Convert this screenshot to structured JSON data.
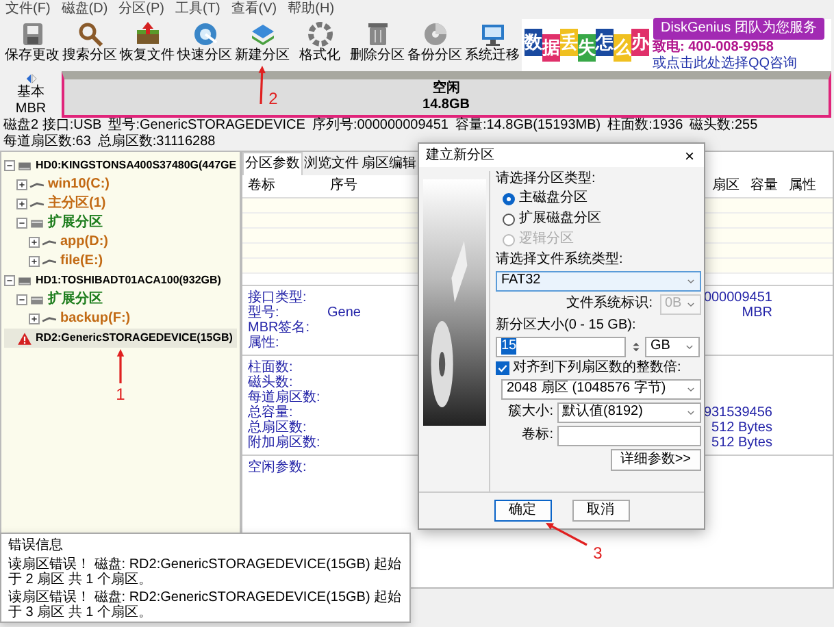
{
  "menu": [
    "文件(F)",
    "磁盘(D)",
    "分区(P)",
    "工具(T)",
    "查看(V)",
    "帮助(H)"
  ],
  "toolbar": [
    {
      "label": "保存更改"
    },
    {
      "label": "搜索分区"
    },
    {
      "label": "恢复文件"
    },
    {
      "label": "快速分区"
    },
    {
      "label": "新建分区"
    },
    {
      "label": "格式化"
    },
    {
      "label": "删除分区"
    },
    {
      "label": "备份分区"
    },
    {
      "label": "系统迁移"
    }
  ],
  "banner": {
    "characters": [
      "数",
      "据",
      "丢",
      "失",
      "怎",
      "么",
      "办"
    ],
    "slogan": "DiskGenius 团队为您服务",
    "phone": "致电: 400-008-9958",
    "note": "或点击此处选择QQ咨询"
  },
  "disk_map": {
    "type_label": "基本",
    "scheme": "MBR",
    "partition_label": "空闲",
    "partition_size": "14.8GB"
  },
  "disk_info": [
    "磁盘2 接口:USB",
    "型号:GenericSTORAGEDEVICE",
    "序列号:000000009451",
    "容量:14.8GB(15193MB)",
    "柱面数:1936",
    "磁头数:255",
    "每道扇区数:63",
    "总扇区数:31116288"
  ],
  "tree": [
    {
      "label": "HD0:KINGSTONSA400S37480G(447GE",
      "kind": "disk",
      "expanded": true,
      "selected": false,
      "children": [
        {
          "label": "win10(C:)",
          "kind": "partition",
          "expanded": false,
          "selected": false
        },
        {
          "label": "主分区(1)",
          "kind": "partition",
          "expanded": false,
          "selected": false
        },
        {
          "label": "扩展分区",
          "kind": "extended",
          "expanded": true,
          "selected": false,
          "children": [
            {
              "label": "app(D:)",
              "kind": "partition",
              "expanded": false,
              "selected": false
            },
            {
              "label": "file(E:)",
              "kind": "partition",
              "expanded": false,
              "selected": false
            }
          ]
        }
      ]
    },
    {
      "label": "HD1:TOSHIBADT01ACA100(932GB)",
      "kind": "disk",
      "expanded": true,
      "selected": false,
      "children": [
        {
          "label": "扩展分区",
          "kind": "extended",
          "expanded": true,
          "selected": false,
          "children": [
            {
              "label": "backup(F:)",
              "kind": "partition",
              "expanded": false,
              "selected": false
            }
          ]
        }
      ]
    },
    {
      "label": "RD2:GenericSTORAGEDEVICE(15GB)",
      "kind": "removable",
      "selected": true
    }
  ],
  "tabs": [
    {
      "label": "分区参数",
      "selected": true
    },
    {
      "label": "浏览文件",
      "selected": false
    },
    {
      "label": "扇区编辑",
      "selected": false
    }
  ],
  "table": {
    "columns": [
      "卷标",
      "序号",
      "扇区",
      "容量",
      "属性"
    ]
  },
  "details": [
    [
      {
        "label": "接口类型:",
        "far_value": "000009451"
      },
      {
        "label": "型号:",
        "value": "Gene",
        "far_value": "MBR"
      },
      {
        "label": "MBR签名:"
      },
      {
        "label": "属性:"
      }
    ],
    [
      {
        "label": "柱面数:"
      },
      {
        "label": "磁头数:"
      },
      {
        "label": "每道扇区数:"
      },
      {
        "label": "总容量:",
        "far_value": "931539456"
      },
      {
        "label": "总扇区数:",
        "far_value": "512 Bytes"
      },
      {
        "label": "附加扇区数:",
        "far_value": "512 Bytes"
      }
    ],
    [
      {
        "label": "空闲参数:"
      }
    ]
  ],
  "error_window": {
    "title": "错误信息",
    "lines": [
      "读扇区错误！ 磁盘: RD2:GenericSTORAGEDEVICE(15GB) 起始于 2 扇区 共 1 个扇区。",
      "读扇区错误！ 磁盘: RD2:GenericSTORAGEDEVICE(15GB) 起始于 3 扇区 共 1 个扇区。"
    ]
  },
  "dialog": {
    "title": "建立新分区",
    "close": "×",
    "type_label": "请选择分区类型:",
    "types": [
      {
        "label": "主磁盘分区",
        "selected": true,
        "disabled": false
      },
      {
        "label": "扩展磁盘分区",
        "selected": false,
        "disabled": false
      },
      {
        "label": "逻辑分区",
        "selected": false,
        "disabled": true
      }
    ],
    "fs_label": "请选择文件系统类型:",
    "fs_value": "FAT32",
    "fs_id_label": "文件系统标识:",
    "fs_id_value": "0B",
    "fs_id_disabled": true,
    "size_label": "新分区大小(0 - 15 GB):",
    "size_value": "15",
    "size_unit": "GB",
    "align": {
      "label": "对齐到下列扇区数的整数倍:",
      "checked": true
    },
    "align_value": "2048 扇区 (1048576 字节)",
    "cluster_label": "簇大小:",
    "cluster_value": "默认值(8192)",
    "volume_label": "卷标:",
    "advanced_button": "详细参数>>",
    "ok_button": "确定",
    "cancel_button": "取消"
  },
  "annotations": [
    {
      "label": "1"
    },
    {
      "label": "2"
    },
    {
      "label": "3"
    }
  ]
}
